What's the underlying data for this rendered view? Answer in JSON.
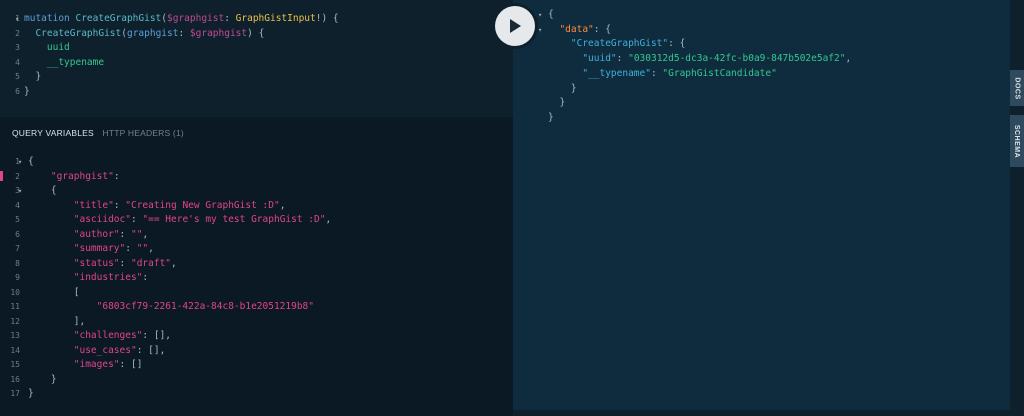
{
  "query": {
    "lines": [
      {
        "n": "1",
        "fold": "▾",
        "tokens": [
          [
            "kw",
            "mutation "
          ],
          [
            "fn",
            "CreateGraphGist"
          ],
          [
            "punc",
            "("
          ],
          [
            "var",
            "$graphgist"
          ],
          [
            "punc",
            ": "
          ],
          [
            "type",
            "GraphGistInput"
          ],
          [
            "punc",
            "!) {"
          ]
        ]
      },
      {
        "n": "2",
        "fold": "",
        "tokens": [
          [
            "punc",
            "  "
          ],
          [
            "fn",
            "CreateGraphGist"
          ],
          [
            "punc",
            "("
          ],
          [
            "kw",
            "graphgist"
          ],
          [
            "punc",
            ": "
          ],
          [
            "var",
            "$graphgist"
          ],
          [
            "punc",
            ") {"
          ]
        ]
      },
      {
        "n": "3",
        "fold": "",
        "tokens": [
          [
            "punc",
            "    "
          ],
          [
            "field",
            "uuid"
          ]
        ]
      },
      {
        "n": "4",
        "fold": "",
        "tokens": [
          [
            "punc",
            "    "
          ],
          [
            "field",
            "__typename"
          ]
        ]
      },
      {
        "n": "5",
        "fold": "",
        "tokens": [
          [
            "punc",
            "  }"
          ]
        ]
      },
      {
        "n": "6",
        "fold": "",
        "tokens": [
          [
            "punc",
            "}"
          ]
        ]
      }
    ]
  },
  "tabs": {
    "query_variables": "QUERY VARIABLES",
    "http_headers": "HTTP HEADERS (1)"
  },
  "variables": {
    "lines": [
      {
        "n": "1",
        "fold": "▾",
        "tokens": [
          [
            "punc",
            "{"
          ]
        ]
      },
      {
        "n": "2",
        "fold": "",
        "tokens": [
          [
            "punc",
            "    "
          ],
          [
            "key",
            "\"graphgist\""
          ],
          [
            "punc",
            ":"
          ]
        ]
      },
      {
        "n": "3",
        "fold": "▾",
        "tokens": [
          [
            "punc",
            "    {"
          ]
        ]
      },
      {
        "n": "4",
        "fold": "",
        "tokens": [
          [
            "punc",
            "        "
          ],
          [
            "key",
            "\"title\""
          ],
          [
            "punc",
            ": "
          ],
          [
            "str",
            "\"Creating New GraphGist :D\""
          ],
          [
            "punc",
            ","
          ]
        ]
      },
      {
        "n": "5",
        "fold": "",
        "tokens": [
          [
            "punc",
            "        "
          ],
          [
            "key",
            "\"asciidoc\""
          ],
          [
            "punc",
            ": "
          ],
          [
            "str",
            "\"== Here's my test GraphGist :D\""
          ],
          [
            "punc",
            ","
          ]
        ]
      },
      {
        "n": "6",
        "fold": "",
        "tokens": [
          [
            "punc",
            "        "
          ],
          [
            "key",
            "\"author\""
          ],
          [
            "punc",
            ": "
          ],
          [
            "str",
            "\"\""
          ],
          [
            "punc",
            ","
          ]
        ]
      },
      {
        "n": "7",
        "fold": "",
        "tokens": [
          [
            "punc",
            "        "
          ],
          [
            "key",
            "\"summary\""
          ],
          [
            "punc",
            ": "
          ],
          [
            "str",
            "\"\""
          ],
          [
            "punc",
            ","
          ]
        ]
      },
      {
        "n": "8",
        "fold": "",
        "tokens": [
          [
            "punc",
            "        "
          ],
          [
            "key",
            "\"status\""
          ],
          [
            "punc",
            ": "
          ],
          [
            "str",
            "\"draft\""
          ],
          [
            "punc",
            ","
          ]
        ]
      },
      {
        "n": "9",
        "fold": "",
        "tokens": [
          [
            "punc",
            "        "
          ],
          [
            "key",
            "\"industries\""
          ],
          [
            "punc",
            ":"
          ]
        ]
      },
      {
        "n": "10",
        "fold": "",
        "tokens": [
          [
            "punc",
            "        ["
          ]
        ]
      },
      {
        "n": "11",
        "fold": "",
        "tokens": [
          [
            "punc",
            "            "
          ],
          [
            "str",
            "\"6803cf79-2261-422a-84c8-b1e2051219b8\""
          ]
        ]
      },
      {
        "n": "12",
        "fold": "",
        "tokens": [
          [
            "punc",
            "        ],"
          ]
        ]
      },
      {
        "n": "13",
        "fold": "",
        "tokens": [
          [
            "punc",
            "        "
          ],
          [
            "key",
            "\"challenges\""
          ],
          [
            "punc",
            ": [],"
          ]
        ]
      },
      {
        "n": "14",
        "fold": "",
        "tokens": [
          [
            "punc",
            "        "
          ],
          [
            "key",
            "\"use_cases\""
          ],
          [
            "punc",
            ": [],"
          ]
        ]
      },
      {
        "n": "15",
        "fold": "",
        "tokens": [
          [
            "punc",
            "        "
          ],
          [
            "key",
            "\"images\""
          ],
          [
            "punc",
            ": []"
          ]
        ]
      },
      {
        "n": "16",
        "fold": "",
        "tokens": [
          [
            "punc",
            "    }"
          ]
        ]
      },
      {
        "n": "17",
        "fold": "",
        "tokens": [
          [
            "punc",
            "}"
          ]
        ]
      }
    ]
  },
  "result": {
    "lines": [
      {
        "fold": "▾",
        "tokens": [
          [
            "punc",
            "{"
          ]
        ]
      },
      {
        "fold": "▾",
        "tokens": [
          [
            "punc",
            "  "
          ],
          [
            "rkey0",
            "\"data\""
          ],
          [
            "punc",
            ": {"
          ]
        ]
      },
      {
        "fold": "",
        "tokens": [
          [
            "punc",
            "    "
          ],
          [
            "rkey",
            "\"CreateGraphGist\""
          ],
          [
            "punc",
            ": {"
          ]
        ]
      },
      {
        "fold": "",
        "tokens": [
          [
            "punc",
            "      "
          ],
          [
            "rkey",
            "\"uuid\""
          ],
          [
            "punc",
            ": "
          ],
          [
            "rstr",
            "\"030312d5-dc3a-42fc-b0a9-847b502e5af2\""
          ],
          [
            "punc",
            ","
          ]
        ]
      },
      {
        "fold": "",
        "tokens": [
          [
            "punc",
            "      "
          ],
          [
            "rkey",
            "\"__typename\""
          ],
          [
            "punc",
            ": "
          ],
          [
            "rstr",
            "\"GraphGistCandidate\""
          ]
        ]
      },
      {
        "fold": "",
        "tokens": [
          [
            "punc",
            "    }"
          ]
        ]
      },
      {
        "fold": "",
        "tokens": [
          [
            "punc",
            "  }"
          ]
        ]
      },
      {
        "fold": "",
        "tokens": [
          [
            "punc",
            "}"
          ]
        ]
      }
    ]
  },
  "sidebar": {
    "docs": "DOCS",
    "schema": "SCHEMA"
  },
  "icons": {
    "play": "play-icon"
  }
}
